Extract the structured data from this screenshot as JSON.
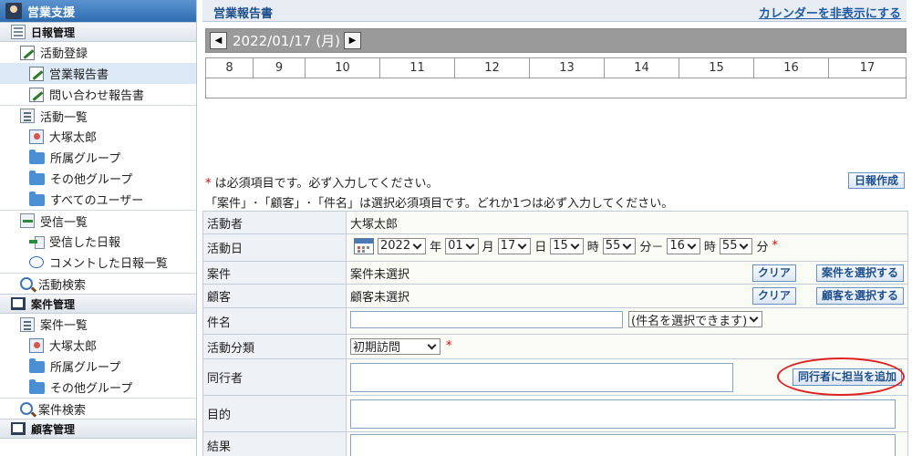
{
  "sidebar": {
    "title": "営業支援",
    "sec_nippo": "日報管理",
    "item_katsudo_toroku": "活動登録",
    "item_eigyo_hokoku": "営業報告書",
    "item_toiawase": "問い合わせ報告書",
    "item_katsudo_ichiran": "活動一覧",
    "item_user1": "大塚太郎",
    "item_shozoku1": "所属グループ",
    "item_sonota1": "その他グループ",
    "item_all_users": "すべてのユーザー",
    "item_jushin": "受信一覧",
    "item_jushin_nippo": "受信した日報",
    "item_comment": "コメントした日報一覧",
    "item_katsudo_kensaku": "活動検索",
    "sec_anken": "案件管理",
    "item_anken_ichiran": "案件一覧",
    "item_user2": "大塚太郎",
    "item_shozoku2": "所属グループ",
    "item_sonota2": "その他グループ",
    "item_anken_kensaku": "案件検索",
    "sec_kokyaku": "顧客管理"
  },
  "header": {
    "title": "営業報告書",
    "toggle_calendar": "カレンダーを非表示にする"
  },
  "datebar": {
    "prev": "◀",
    "date": "2022/01/17 (月)",
    "next": "▶"
  },
  "hours": [
    "8",
    "9",
    "10",
    "11",
    "12",
    "13",
    "14",
    "15",
    "16",
    "17"
  ],
  "notice": {
    "star": "*",
    "required": "は必須項目です。必ず入力してください。",
    "select_required": "「案件」･「顧客」･「件名」は選択必須項目です。どれか1つは必ず入力してください。"
  },
  "btn_daily": "日報作成",
  "form": {
    "actor_label": "活動者",
    "actor_value": "大塚太郎",
    "date_label": "活動日",
    "year": "2022",
    "year_unit": "年",
    "month": "01",
    "month_unit": "月",
    "day": "17",
    "day_unit": "日",
    "hour_from": "15",
    "hour_unit1": "時",
    "min_from": "55",
    "min_unit1": "分－",
    "hour_to": "16",
    "hour_unit2": "時",
    "min_to": "55",
    "min_unit2": "分",
    "anken_label": "案件",
    "anken_value": "案件未選択",
    "clear": "クリア",
    "anken_select": "案件を選択する",
    "kokyaku_label": "顧客",
    "kokyaku_value": "顧客未選択",
    "kokyaku_select": "顧客を選択する",
    "kenmei_label": "件名",
    "kenmei_select": "(件名を選択できます)",
    "bunrui_label": "活動分類",
    "bunrui_value": "初期訪問",
    "doko_label": "同行者",
    "doko_add": "同行者に担当を追加",
    "mokuteki_label": "目的",
    "kekka_label": "結果"
  }
}
